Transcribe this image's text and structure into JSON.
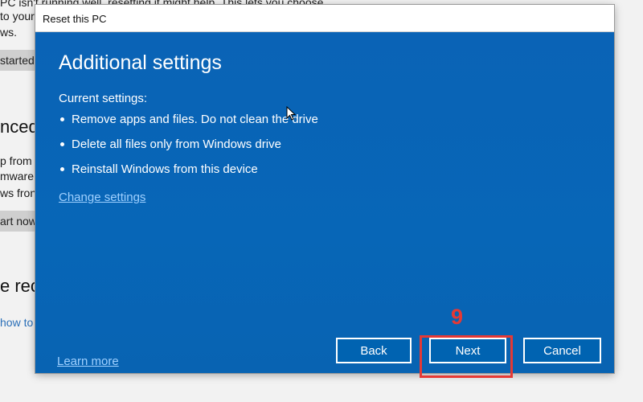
{
  "background": {
    "line1": "PC isn't running well, resetting it might help. This lets you choose",
    "line2": "to your",
    "line3": "ws.",
    "get_started": "started",
    "advanced_heading": "nced",
    "line4": "p from",
    "line5": "mware",
    "line6": "ws fron",
    "restart_now": "art now",
    "recovery_heading": "e reco",
    "how_to_link": "how to"
  },
  "dialog": {
    "title": "Reset this PC",
    "heading": "Additional settings",
    "current_label": "Current settings:",
    "settings": [
      "Remove apps and files. Do not clean the drive",
      "Delete all files only from Windows drive",
      "Reinstall Windows from this device"
    ],
    "change_settings": "Change settings",
    "learn_more": "Learn more",
    "back_label": "Back",
    "next_label": "Next",
    "cancel_label": "Cancel"
  },
  "annotation": {
    "step_number": "9",
    "color": "#e53935"
  },
  "colors": {
    "dialog_blue": "#0063b1",
    "link_blue": "#9fd0ff"
  }
}
